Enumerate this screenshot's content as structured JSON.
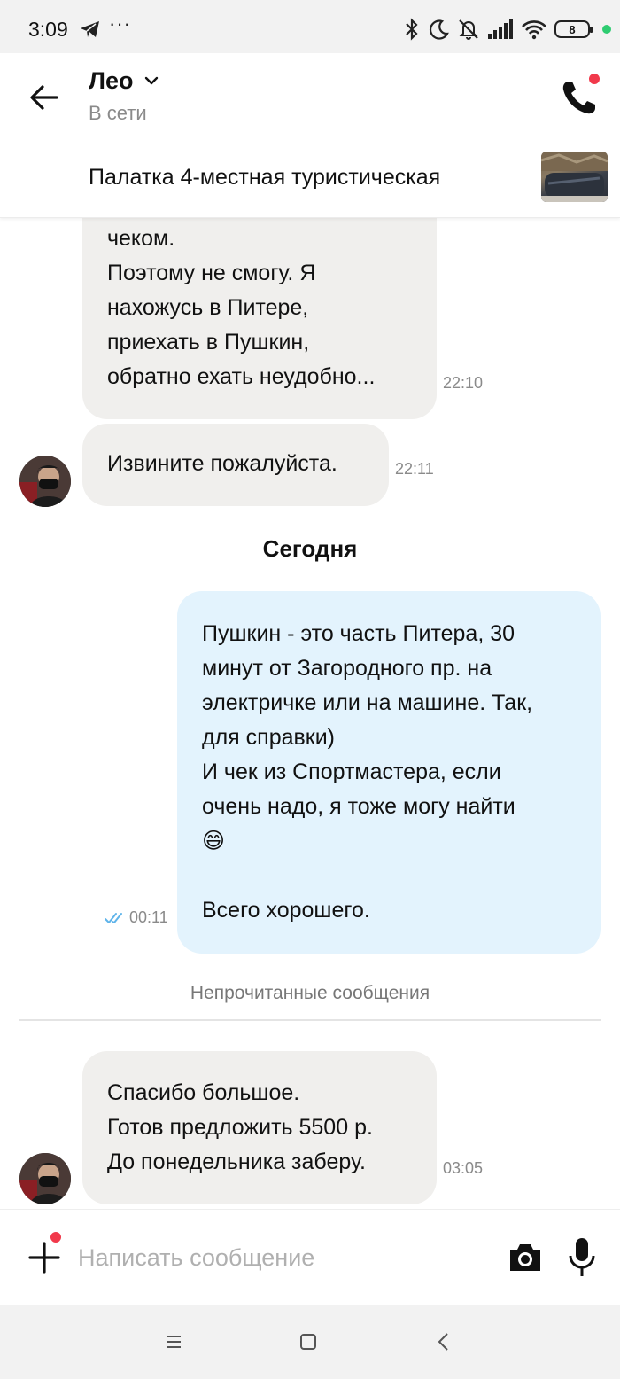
{
  "status_bar": {
    "time": "3:09",
    "dots": "···",
    "battery": "8",
    "icons": [
      "telegram-icon",
      "bluetooth-icon",
      "moon-icon",
      "bell-muted-icon",
      "signal-icon",
      "wifi-icon",
      "battery-icon"
    ]
  },
  "header": {
    "name": "Лео",
    "status": "В сети"
  },
  "product": {
    "title": "Палатка 4-местная туристическая"
  },
  "messages": [
    {
      "direction": "in",
      "lines": [
        "чеком.",
        "Поэтому не смогу. Я",
        "нахожусь в Питере,",
        "приехать в Пушкин,",
        "обратно ехать неудобно..."
      ],
      "time": "22:10"
    },
    {
      "direction": "in",
      "lines": [
        "Извините пожалуйста."
      ],
      "time": "22:11"
    },
    {
      "direction": "out",
      "lines": [
        "Пушкин - это часть Питера, 30",
        "минут от Загородного пр. на",
        "электричке или на машине. Так,",
        "для справки)",
        "И чек из Спортмастера, если",
        "очень надо, я тоже могу найти",
        "😄",
        "",
        "Всего хорошего."
      ],
      "time": "00:11",
      "read": true
    },
    {
      "direction": "in",
      "lines": [
        "Спасибо большое.",
        "Готов предложить 5500 р.",
        "До понедельника заберу."
      ],
      "time": "03:05"
    }
  ],
  "day_separator": "Сегодня",
  "unread_label": "Непрочитанные сообщения",
  "composer": {
    "placeholder": "Написать сообщение"
  },
  "colors": {
    "incoming_bubble": "#f0efed",
    "outgoing_bubble": "#e3f3fd",
    "notification_dot": "#f1394b",
    "read_check": "#5fb4ea"
  }
}
